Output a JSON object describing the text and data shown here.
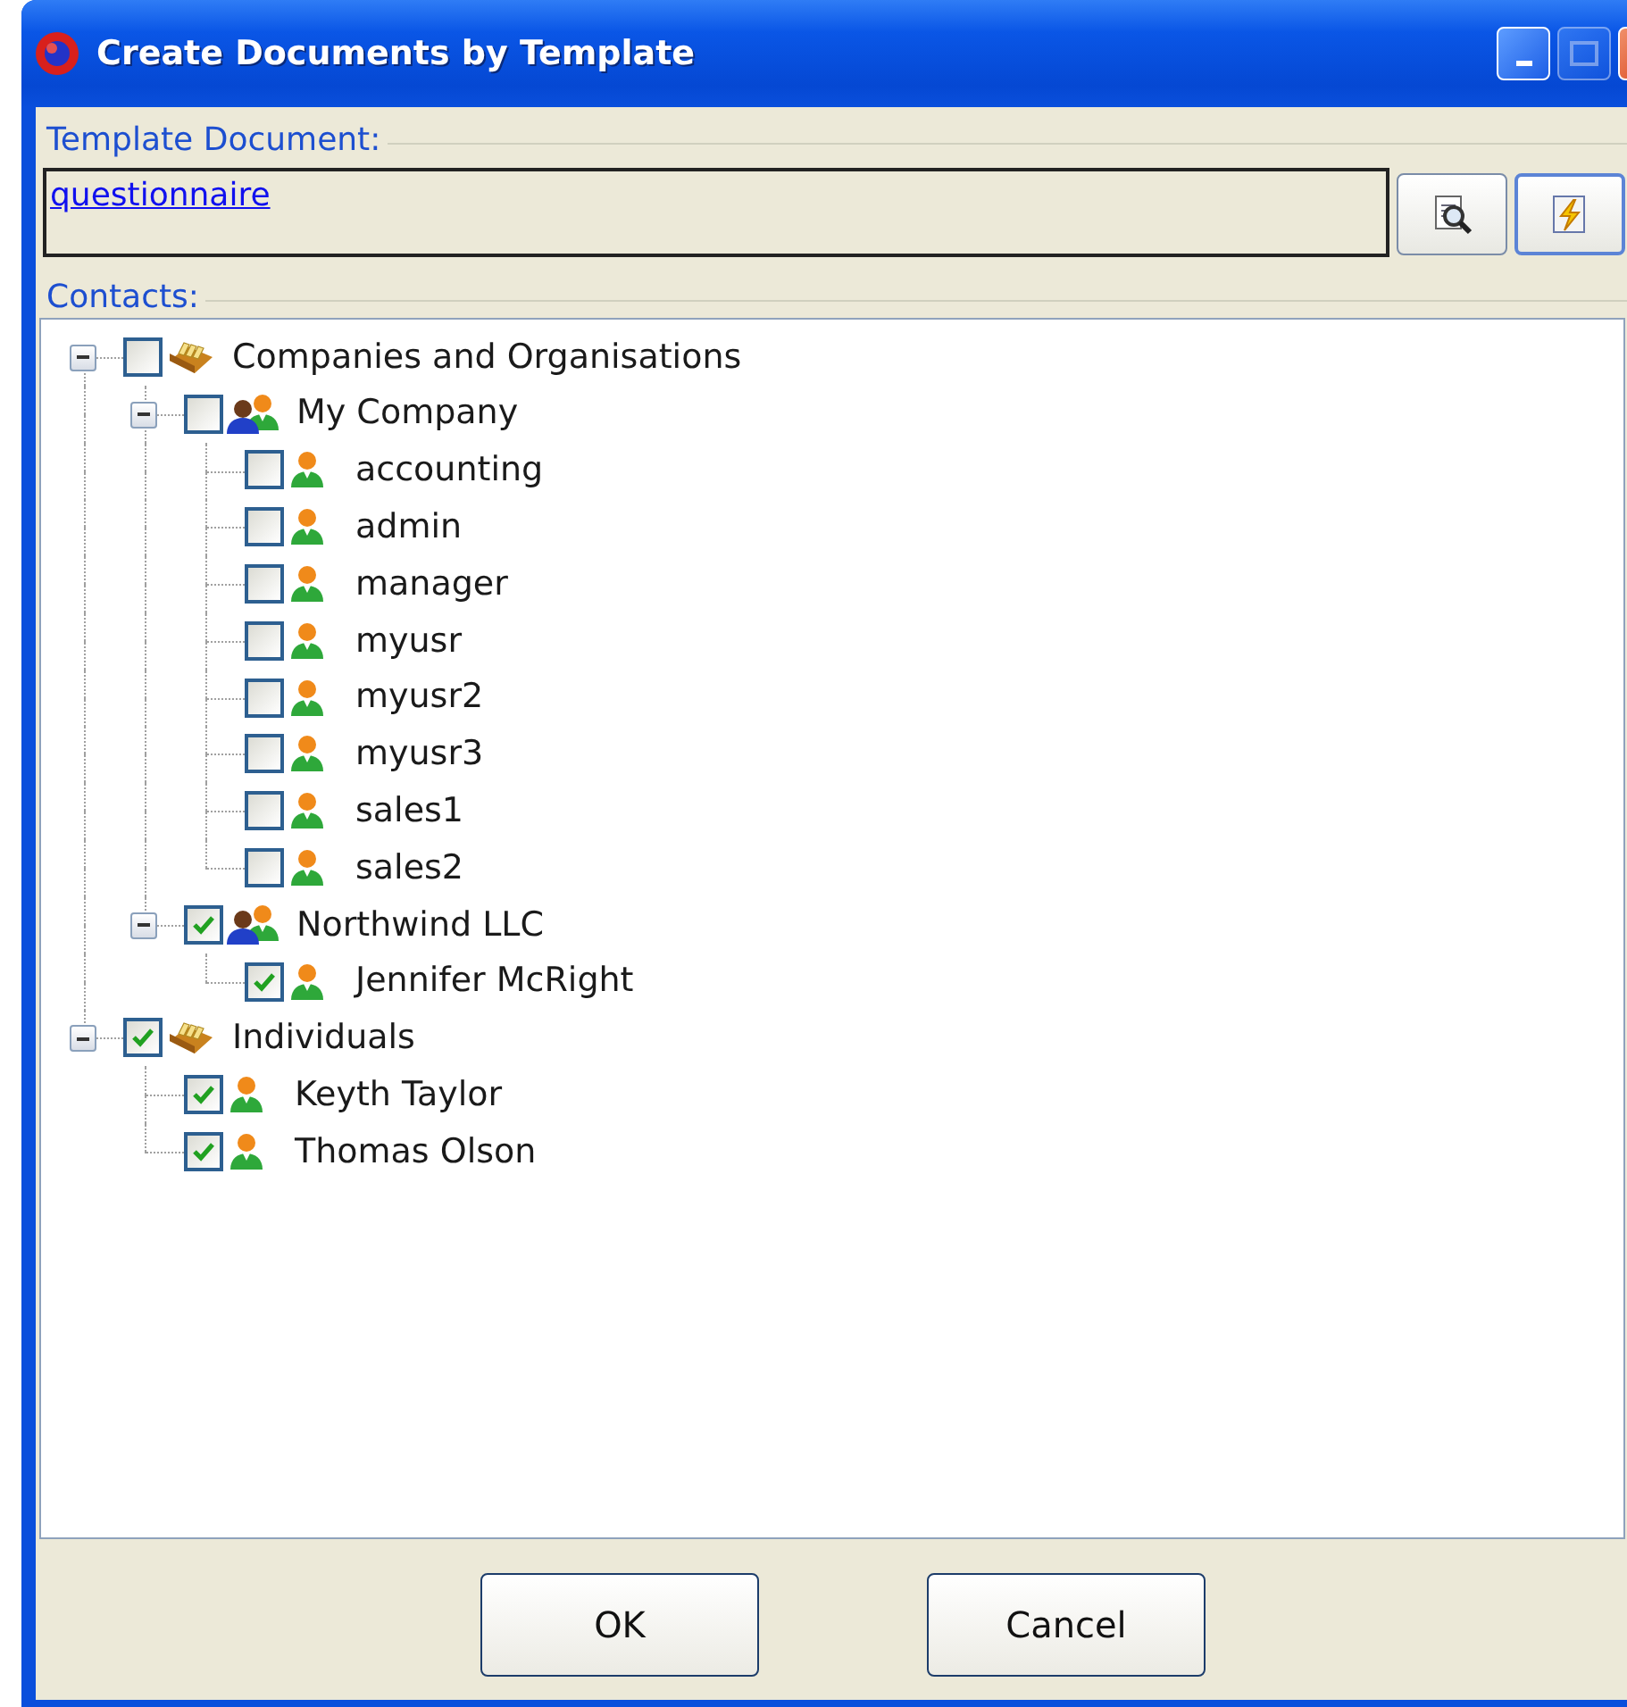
{
  "window": {
    "title": "Create Documents by Template",
    "buttons": [
      {
        "kind": "minimize",
        "disabled": false
      },
      {
        "kind": "maximize",
        "disabled": true
      },
      {
        "kind": "close",
        "disabled": false
      }
    ]
  },
  "template_document": {
    "label": "Template Document:",
    "value": "questionnaire",
    "buttons": [
      {
        "kind": "preview"
      },
      {
        "kind": "generate"
      }
    ]
  },
  "contacts": {
    "label": "Contacts:",
    "tree": [
      {
        "label": "Companies and Organisations",
        "kind": "folder",
        "checked": false,
        "expanded": true,
        "children": [
          {
            "label": "My Company",
            "kind": "group",
            "checked": false,
            "expanded": true,
            "children": [
              {
                "label": "accounting",
                "kind": "person",
                "checked": false
              },
              {
                "label": "admin",
                "kind": "person",
                "checked": false
              },
              {
                "label": "manager",
                "kind": "person",
                "checked": false
              },
              {
                "label": "myusr",
                "kind": "person",
                "checked": false
              },
              {
                "label": "myusr2",
                "kind": "person",
                "checked": false
              },
              {
                "label": "myusr3",
                "kind": "person",
                "checked": false
              },
              {
                "label": "sales1",
                "kind": "person",
                "checked": false
              },
              {
                "label": "sales2",
                "kind": "person",
                "checked": false
              }
            ]
          },
          {
            "label": "Northwind LLC",
            "kind": "group",
            "checked": true,
            "expanded": true,
            "children": [
              {
                "label": "Jennifer McRight",
                "kind": "person",
                "checked": true
              }
            ]
          }
        ]
      },
      {
        "label": "Individuals",
        "kind": "folder",
        "checked": true,
        "expanded": true,
        "children": [
          {
            "label": "Keyth Taylor",
            "kind": "person",
            "checked": true
          },
          {
            "label": "Thomas Olson",
            "kind": "person",
            "checked": true
          }
        ]
      }
    ]
  },
  "buttons": [
    {
      "label": "OK"
    },
    {
      "label": "Cancel"
    }
  ]
}
